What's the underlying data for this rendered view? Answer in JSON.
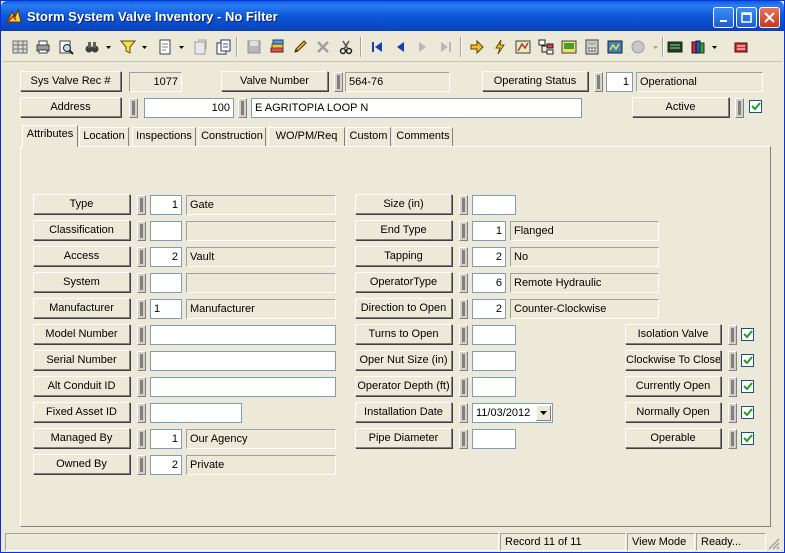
{
  "window": {
    "title": "Storm System Valve Inventory - No Filter"
  },
  "header": {
    "rec_label": "Sys Valve Rec #",
    "rec_value": "1077",
    "valve_label": "Valve Number",
    "valve_value": "564-76",
    "status_label": "Operating Status",
    "status_code": "1",
    "status_value": "Operational",
    "address_label": "Address",
    "address_number": "100",
    "address_street": "E AGRITOPIA LOOP N",
    "active_label": "Active",
    "active_checked": true
  },
  "tabs": [
    {
      "label": "Attributes"
    },
    {
      "label": "Location"
    },
    {
      "label": "Inspections"
    },
    {
      "label": "Construction"
    },
    {
      "label": "WO/PM/Req"
    },
    {
      "label": "Custom"
    },
    {
      "label": "Comments"
    }
  ],
  "left_fields": [
    {
      "label": "Type",
      "code": "1",
      "value": "Gate"
    },
    {
      "label": "Classification",
      "code": "",
      "value": ""
    },
    {
      "label": "Access",
      "code": "2",
      "value": "Vault"
    },
    {
      "label": "System",
      "code": "",
      "value": ""
    },
    {
      "label": "Manufacturer",
      "code": "1",
      "value": "Manufacturer"
    },
    {
      "label": "Model Number",
      "value": ""
    },
    {
      "label": "Serial Number",
      "value": ""
    },
    {
      "label": "Alt Conduit ID",
      "value": ""
    },
    {
      "label": "Fixed Asset ID",
      "value": ""
    },
    {
      "label": "Managed By",
      "code": "1",
      "value": "Our Agency"
    },
    {
      "label": "Owned By",
      "code": "2",
      "value": "Private"
    }
  ],
  "mid_fields": [
    {
      "label": "Size (in)",
      "code": "",
      "value": ""
    },
    {
      "label": "End Type",
      "code": "1",
      "value": "Flanged"
    },
    {
      "label": "Tapping",
      "code": "2",
      "value": "No"
    },
    {
      "label": "OperatorType",
      "code": "6",
      "value": "Remote Hydraulic"
    },
    {
      "label": "Direction to Open",
      "code": "2",
      "value": "Counter-Clockwise"
    },
    {
      "label": "Turns to Open",
      "code": ""
    },
    {
      "label": "Oper Nut Size (in)",
      "code": ""
    },
    {
      "label": "Operator Depth (ft)",
      "code": ""
    },
    {
      "label": "Installation Date",
      "value": "11/03/2012"
    },
    {
      "label": "Pipe Diameter",
      "code": ""
    }
  ],
  "checks": [
    {
      "label": "Isolation Valve",
      "checked": true
    },
    {
      "label": "Clockwise To Close",
      "checked": true
    },
    {
      "label": "Currently Open",
      "checked": true
    },
    {
      "label": "Normally Open",
      "checked": true
    },
    {
      "label": "Operable",
      "checked": true
    }
  ],
  "status": {
    "record": "Record 11 of 11",
    "mode": "View Mode",
    "state": "Ready..."
  }
}
